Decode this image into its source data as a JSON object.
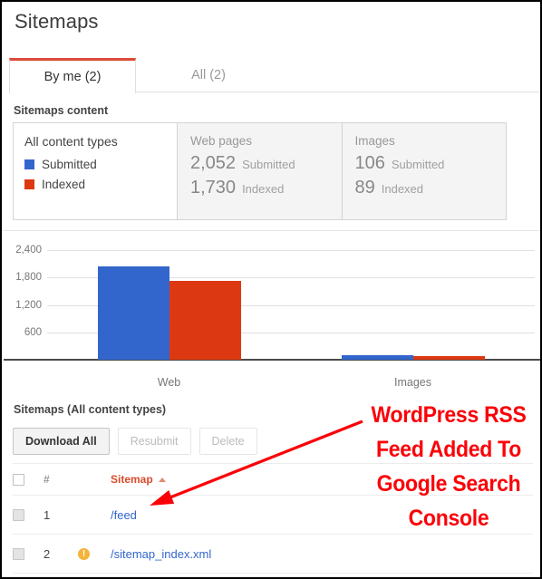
{
  "page": {
    "title": "Sitemaps"
  },
  "tabs": [
    {
      "label": "By me (2)",
      "active": true
    },
    {
      "label": "All (2)",
      "active": false
    }
  ],
  "sitemaps_content": {
    "section_label": "Sitemaps content",
    "legend": {
      "title": "All content types",
      "items": [
        {
          "label": "Submitted",
          "color": "#3366cc"
        },
        {
          "label": "Indexed",
          "color": "#dc3912"
        }
      ]
    },
    "metrics": [
      {
        "title": "Web pages",
        "submitted_value": "2,052",
        "submitted_label": "Submitted",
        "indexed_value": "1,730",
        "indexed_label": "Indexed"
      },
      {
        "title": "Images",
        "submitted_value": "106",
        "submitted_label": "Submitted",
        "indexed_value": "89",
        "indexed_label": "Indexed"
      }
    ]
  },
  "chart_data": {
    "type": "bar",
    "title": "",
    "xlabel": "",
    "ylabel": "",
    "categories": [
      "Web",
      "Images"
    ],
    "series": [
      {
        "name": "Submitted",
        "color": "#3366cc",
        "values": [
          2052,
          106
        ]
      },
      {
        "name": "Indexed",
        "color": "#dc3912",
        "values": [
          1730,
          89
        ]
      }
    ],
    "ylim": [
      0,
      2600
    ],
    "yticks": [
      600,
      1200,
      1800,
      2400
    ],
    "ytick_labels": [
      "600",
      "1,200",
      "1,800",
      "2,400"
    ],
    "grid": true,
    "legend_position": "external-card"
  },
  "sitemaps_table": {
    "section_label": "Sitemaps (All content types)",
    "toolbar": [
      {
        "label": "Download All",
        "state": "enabled"
      },
      {
        "label": "Resubmit",
        "state": "disabled"
      },
      {
        "label": "Delete",
        "state": "disabled"
      }
    ],
    "columns": {
      "number": "#",
      "sitemap": "Sitemap",
      "sort": "ascending"
    },
    "rows": [
      {
        "number": "1",
        "sitemap": "/feed",
        "warning": false
      },
      {
        "number": "2",
        "sitemap": "/sitemap_index.xml",
        "warning": true,
        "warning_glyph": "!"
      }
    ]
  },
  "annotation": {
    "text": "WordPress RSS Feed Added To Google Search Console",
    "lines": [
      "WordPress RSS",
      "Feed Added To",
      "Google Search",
      "Console"
    ],
    "color": "#fb0007",
    "arrow": {
      "from_x": 398,
      "from_y": 463,
      "to_x": 163,
      "to_y": 556
    }
  }
}
